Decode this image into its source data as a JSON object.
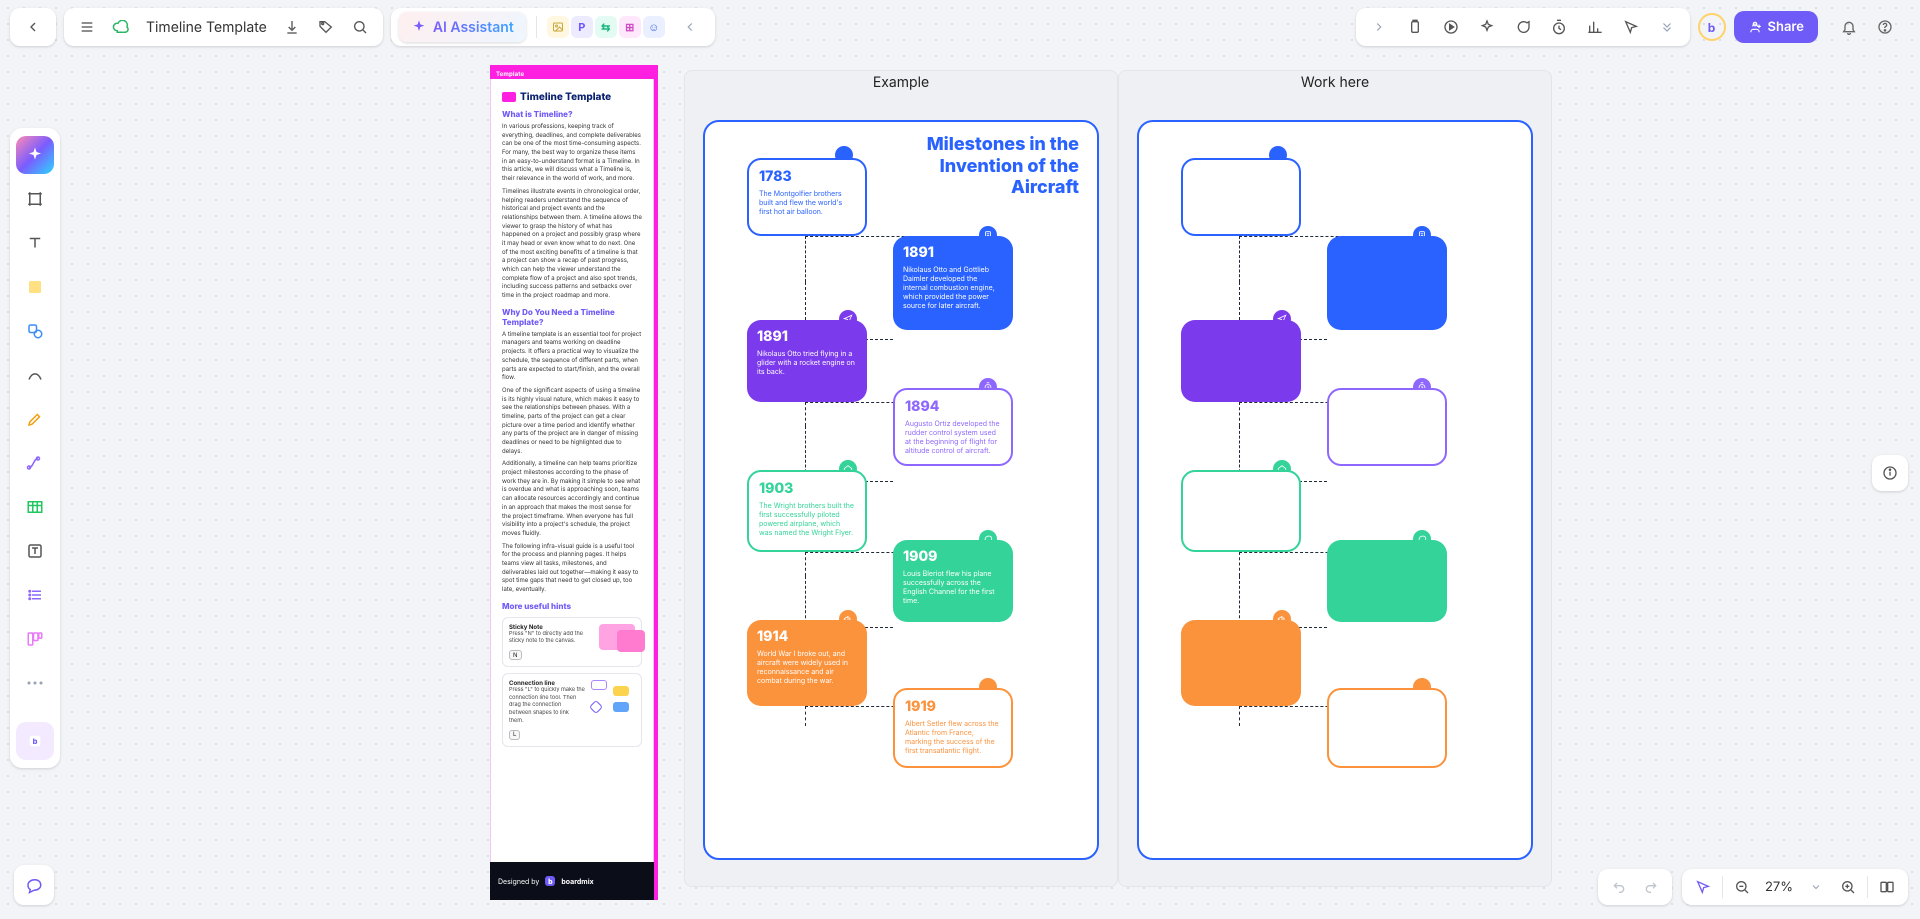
{
  "header": {
    "title": "Timeline Template",
    "ai_label": "AI Assistant",
    "tokens": [
      "P",
      "⇆",
      "⊞",
      "☺"
    ]
  },
  "share": {
    "label": "Share"
  },
  "zoom": {
    "value": "27%"
  },
  "frames": {
    "example": "Example",
    "work": "Work here"
  },
  "board": {
    "title": "Milestones in the Invention of the Aircraft"
  },
  "doc": {
    "topbar": "Template",
    "h_title": "Timeline Template",
    "h1": "What is Timeline?",
    "p1": "In various professions, keeping track of everything, deadlines, and complete deliverables can be one of the most time-consuming aspects. For many, the best way to organize these items in an easy-to-understand format is a Timeline. In this article, we will discuss what a Timeline is, their relevance in the world of work, and more.",
    "p1b": "Timelines illustrate events in chronological order, helping readers understand the sequence of historical and project events and the relationships between them. A timeline allows the viewer to grasp the history of what has happened on a project and possibly grasp where it may head or even know what to do next. One of the most exciting benefits of a timeline is that a project can show a recap of past progress, which can help the viewer understand the complete flow of a project and also spot trends, including success patterns and setbacks over time in the project roadmap and more.",
    "h2": "Why Do You Need a Timeline Template?",
    "p2": "A timeline template is an essential tool for project managers and teams working on deadline projects. It offers a practical way to visualize the schedule, the sequence of different parts, when parts are expected to start/finish, and the overall flow.",
    "p2b": "One of the significant aspects of using a timeline is its highly visual nature, which makes it easy to see the relationships between phases. With a timeline, parts of the project can get a clear picture over a time period and identify whether any parts of the project are in danger of missing deadlines or need to be highlighted due to delays.",
    "p2c": "Additionally, a timeline can help teams prioritize project milestones according to the phase of work they are in. By making it simple to see what is overdue and what is approaching soon, teams can allocate resources accordingly and continue in an approach that makes the most sense for the project timeframe. When everyone has full visibility into a project's schedule, the project moves fluidly.",
    "p2d": "The following infra-visual guide is a useful tool for the process and planning pages. It helps teams view all tasks, milestones, and deliverables laid out together—making it easy to spot time gaps that need to get closed up, too late, eventually.",
    "h3": "More useful hints",
    "sticky": {
      "title": "Sticky Note",
      "text": "Press \"N\" to directly add the sticky note to the canvas."
    },
    "sticky_k": "N",
    "connect": {
      "title": "Connection line",
      "text": "Press \"L\" to quickly make the connection line tool. Then drag the connection between shapes to link them."
    },
    "connect_k": "L",
    "footer_brand": "boardmix",
    "footer_lead": "Designed by"
  },
  "timeline": [
    {
      "year": "1783",
      "desc": "The Montgolfier brothers built and flew the world's first hot air balloon.",
      "color": "blue",
      "style": "outline",
      "side": "left"
    },
    {
      "year": "1891",
      "desc": "Nikolaus Otto and Gottlieb Daimler developed the internal combustion engine, which provided the power source for later aircraft.",
      "color": "blue",
      "style": "filled",
      "side": "right"
    },
    {
      "year": "1891",
      "desc": "Nikolaus Otto tried flying in a glider with a rocket engine on its back.",
      "color": "purple",
      "style": "filled",
      "side": "left"
    },
    {
      "year": "1894",
      "desc": "Augusto Ortiz developed the rudder control system used at the beginning of flight for altitude control of aircraft.",
      "color": "violet",
      "style": "outline",
      "side": "right"
    },
    {
      "year": "1903",
      "desc": "The Wright brothers built the first successfully piloted powered airplane, which was named the Wright Flyer.",
      "color": "green",
      "style": "outline",
      "side": "left"
    },
    {
      "year": "1909",
      "desc": "Louis Bleriot flew his plane successfully across the English Channel for the first time.",
      "color": "green",
      "style": "filled",
      "side": "right"
    },
    {
      "year": "1914",
      "desc": "World War I broke out, and aircraft were widely used in reconnaissance and air combat during the war.",
      "color": "orange",
      "style": "filled",
      "side": "left"
    },
    {
      "year": "1919",
      "desc": "Albert Setler flew across the Atlantic from France, marking the success of the first transatlantic flight.",
      "color": "orange",
      "style": "outline",
      "side": "right"
    }
  ],
  "chart_data": {
    "type": "timeline",
    "title": "Milestones in the Invention of the Aircraft",
    "events": [
      {
        "year": 1783,
        "label": "The Montgolfier brothers built and flew the world's first hot air balloon."
      },
      {
        "year": 1891,
        "label": "Nikolaus Otto and Gottlieb Daimler developed the internal combustion engine, which provided the power source for later aircraft."
      },
      {
        "year": 1891,
        "label": "Nikolaus Otto tried flying in a glider with a rocket engine on its back."
      },
      {
        "year": 1894,
        "label": "Augusto Ortiz developed the rudder control system used at the beginning of flight for altitude control of aircraft."
      },
      {
        "year": 1903,
        "label": "The Wright brothers built the first successfully piloted powered airplane, which was named the Wright Flyer."
      },
      {
        "year": 1909,
        "label": "Louis Bleriot flew his plane successfully across the English Channel for the first time."
      },
      {
        "year": 1914,
        "label": "World War I broke out, and aircraft were widely used in reconnaissance and air combat during the war."
      },
      {
        "year": 1919,
        "label": "Albert Setler flew across the Atlantic from France, marking the success of the first transatlantic flight."
      }
    ]
  }
}
